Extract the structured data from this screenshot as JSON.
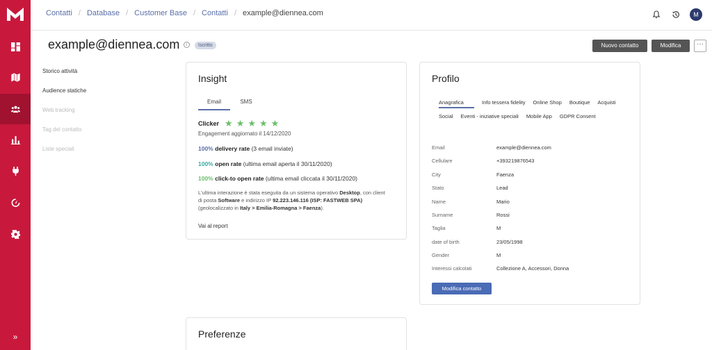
{
  "breadcrumb": [
    "Contatti",
    "Database",
    "Customer Base",
    "Contatti",
    "example@diennea.com"
  ],
  "user": {
    "initial": "M"
  },
  "header": {
    "title": "example@diennea.com",
    "info_icon": "i",
    "status_badge": "Iscritto",
    "new_contact_label": "Nuovo contatto",
    "edit_label": "Modifica",
    "more_label": "···"
  },
  "left_menu": [
    {
      "label": "Storico attività",
      "enabled": true
    },
    {
      "label": "Audience statiche",
      "enabled": true
    },
    {
      "label": "Web tracking",
      "enabled": false
    },
    {
      "label": "Tag del contatto",
      "enabled": false
    },
    {
      "label": "Liste speciali",
      "enabled": false
    }
  ],
  "insight": {
    "title": "Insight",
    "tabs": [
      "Email",
      "SMS"
    ],
    "active_tab": "Email",
    "clicker_label": "Clicker",
    "stars": {
      "rating": 5,
      "max": 5,
      "glyph": "★"
    },
    "engagement_updated": "Engagement aggiornato il 14/12/2020",
    "metrics": [
      {
        "pct": "100%",
        "label": "delivery rate",
        "detail": "(3 email inviate)"
      },
      {
        "pct": "100%",
        "label": "open rate",
        "detail": "(ultima email aperta il 30/11/2020)"
      },
      {
        "pct": "100%",
        "label": "click-to open rate",
        "detail": "(ultima email cliccata il 30/11/2020)"
      }
    ],
    "interaction": {
      "t1": "L'ultima interazione è stata eseguita da un sistema operativo",
      "os": "Desktop",
      "t2": ", con client di posta",
      "client": "Software",
      "t3": "e indirizzo IP",
      "ip": "92.223.146.116 (ISP: FASTWEB SPA)",
      "t4": "(geolocalizzato in",
      "geo": "Italy > Emilia-Romagna > Faenza",
      "t5": ")."
    },
    "report_link": "Vai al report"
  },
  "profile": {
    "title": "Profilo",
    "tabs": [
      "Anagrafica",
      "Info tessera fidelity",
      "Online Shop",
      "Boutique",
      "Acquisti",
      "Social",
      "Eventi - iniziative speciali",
      "Mobile App",
      "GDPR Consent"
    ],
    "active_tab": "Anagrafica",
    "fields": [
      {
        "label": "Email",
        "value": "example@diennea.com"
      },
      {
        "label": "Cellulare",
        "value": "+393219876543"
      },
      {
        "label": "City",
        "value": "Faenza"
      },
      {
        "label": "Stato",
        "value": "Lead"
      },
      {
        "label": "Name",
        "value": "Mario"
      },
      {
        "label": "Surname",
        "value": "Rossi"
      },
      {
        "label": "Taglia",
        "value": "M"
      },
      {
        "label": "date of birth",
        "value": "23/05/1998"
      },
      {
        "label": "Gender",
        "value": "M"
      },
      {
        "label": "Interessi calcolati",
        "value": "Collezione A, Accessori, Donna"
      }
    ],
    "edit_button": "Modifica contatto"
  },
  "preferences": {
    "title": "Preferenze"
  },
  "sidebar": {
    "icons": [
      "dashboard-icon",
      "map-icon",
      "contacts-icon",
      "reports-icon",
      "plug-icon",
      "gauge-icon",
      "settings-icon"
    ],
    "expand_label": "»"
  },
  "colors": {
    "brand": "#c8193c",
    "accent": "#5b6fa8",
    "button_dark": "#555555",
    "primary": "#4a6bb5",
    "star": "#6cbf6c"
  }
}
